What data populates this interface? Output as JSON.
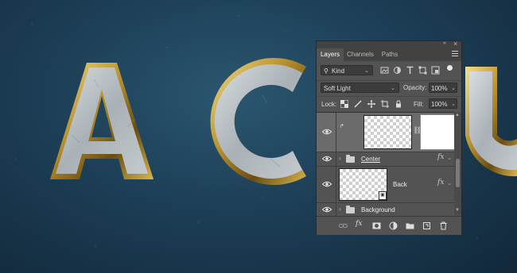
{
  "panel": {
    "tabs": [
      {
        "label": "Layers",
        "active": true
      },
      {
        "label": "Channels",
        "active": false
      },
      {
        "label": "Paths",
        "active": false
      }
    ],
    "filter": {
      "kind_label": "Kind"
    },
    "blend": {
      "mode": "Soft Light",
      "opacity_label": "Opacity:",
      "opacity_value": "100%"
    },
    "lock": {
      "label": "Lock:",
      "fill_label": "Fill:",
      "fill_value": "100%"
    },
    "layers": [
      {
        "name": "",
        "selected": true,
        "type": "layer-with-mask"
      },
      {
        "name": "Center",
        "type": "group",
        "has_fx": true
      },
      {
        "name": "Back",
        "type": "smart-object",
        "has_fx": true
      },
      {
        "name": "Background",
        "type": "group"
      }
    ],
    "icons": {
      "fx": "fx"
    }
  },
  "colors": {
    "panel_bg": "#535353",
    "selected_layer": "#6b6b6b",
    "canvas_bg": "#1d3f57",
    "gold": "#b8912e"
  }
}
